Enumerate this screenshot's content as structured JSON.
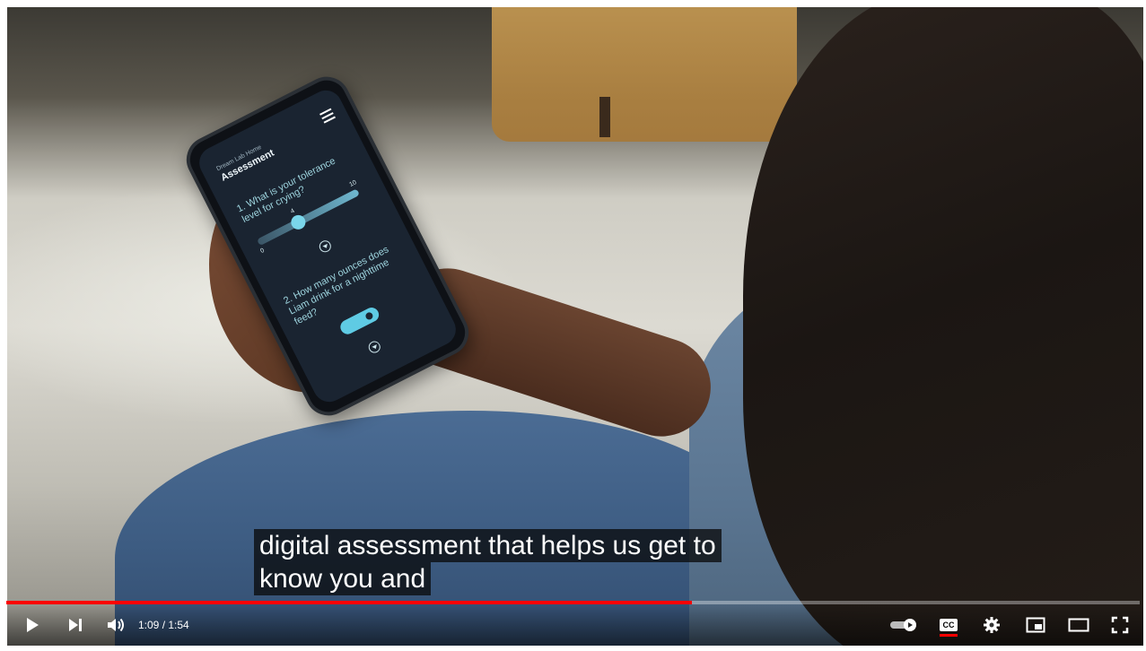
{
  "app": {
    "phone_app": {
      "brand": "Dream Lab Home",
      "screen_title": "Assessment",
      "question_1": "1. What is your tolerance level for crying?",
      "slider_min": "0",
      "slider_max": "10",
      "slider_value": "4",
      "question_2": "2. How many ounces does Liam drink for a nighttime feed?"
    }
  },
  "captions": {
    "line_1": "digital assessment that helps us get to",
    "line_2": "know you and"
  },
  "controls": {
    "time_display": "1:09 / 1:54",
    "cc_label": "CC",
    "progress_fraction": 0.605,
    "accent_color": "#ff0000"
  },
  "icons": [
    "play-icon",
    "next-icon",
    "volume-icon",
    "autoplay-toggle-icon",
    "cc-icon",
    "settings-gear-icon",
    "miniplayer-icon",
    "theater-mode-icon",
    "fullscreen-icon"
  ]
}
